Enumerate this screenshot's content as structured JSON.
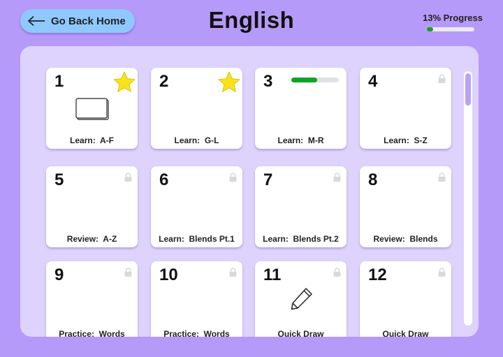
{
  "header": {
    "back_label": "Go Back Home",
    "title": "English",
    "progress_label": "13% Progress",
    "progress_value": 0.13
  },
  "colors": {
    "background": "#b69af9",
    "panel": "#ddd3fd",
    "back_button": "#8fc8ff",
    "progress": "#10a326",
    "star": "#f9e21c"
  },
  "lessons": [
    {
      "number": "1",
      "label": "Learn:  A-F",
      "status": "completed",
      "icon": "flashcards-icon"
    },
    {
      "number": "2",
      "label": "Learn:  G-L",
      "status": "completed"
    },
    {
      "number": "3",
      "label": "Learn:  M-R",
      "status": "in-progress",
      "progress": 0.55
    },
    {
      "number": "4",
      "label": "Learn:  S-Z",
      "status": "locked"
    },
    {
      "number": "5",
      "label": "Review:  A-Z",
      "status": "locked"
    },
    {
      "number": "6",
      "label": "Learn:  Blends Pt.1",
      "status": "locked"
    },
    {
      "number": "7",
      "label": "Learn:  Blends Pt.2",
      "status": "locked"
    },
    {
      "number": "8",
      "label": "Review:  Blends",
      "status": "locked"
    },
    {
      "number": "9",
      "label": "Practice:  Words",
      "status": "locked"
    },
    {
      "number": "10",
      "label": "Practice:  Words",
      "status": "locked"
    },
    {
      "number": "11",
      "label": "Quick Draw",
      "status": "locked",
      "icon": "pencil-icon"
    },
    {
      "number": "12",
      "label": "Quick Draw",
      "status": "locked"
    }
  ]
}
